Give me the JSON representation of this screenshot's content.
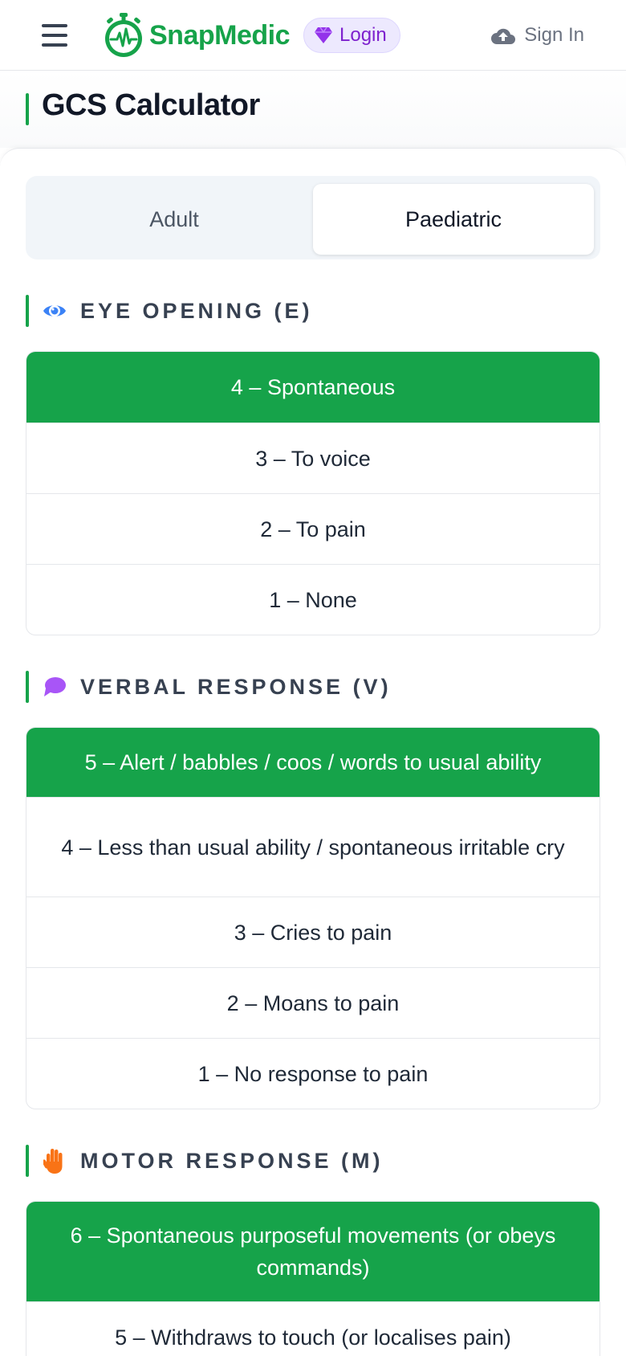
{
  "header": {
    "brand": "SnapMedic",
    "login_label": "Login",
    "signin_label": "Sign In",
    "brand_color": "#16a34a",
    "login_color": "#7e22ce"
  },
  "page": {
    "title": "GCS Calculator"
  },
  "tabs": [
    {
      "label": "Adult",
      "selected": false
    },
    {
      "label": "Paediatric",
      "selected": true
    }
  ],
  "sections": {
    "eye": {
      "heading": "EYE OPENING (E)",
      "icon": "eye-icon",
      "options": [
        "4 – Spontaneous",
        "3 – To voice",
        "2 – To pain",
        "1 – None"
      ],
      "selected_index": 0
    },
    "verbal": {
      "heading": "VERBAL RESPONSE (V)",
      "icon": "speech-bubble-icon",
      "options": [
        "5 – Alert / babbles / coos / words to usual ability",
        "4 – Less than usual ability / spontaneous irritable cry",
        "3 – Cries to pain",
        "2 – Moans to pain",
        "1 – No response to pain"
      ],
      "selected_index": 0
    },
    "motor": {
      "heading": "MOTOR RESPONSE (M)",
      "icon": "hand-icon",
      "options": [
        "6 – Spontaneous purposeful movements (or obeys commands)",
        "5 – Withdraws to touch (or localises pain)"
      ],
      "selected_index": 0
    }
  },
  "colors": {
    "selected_bg": "#16a34a",
    "accent_bar": "#16a34a"
  }
}
